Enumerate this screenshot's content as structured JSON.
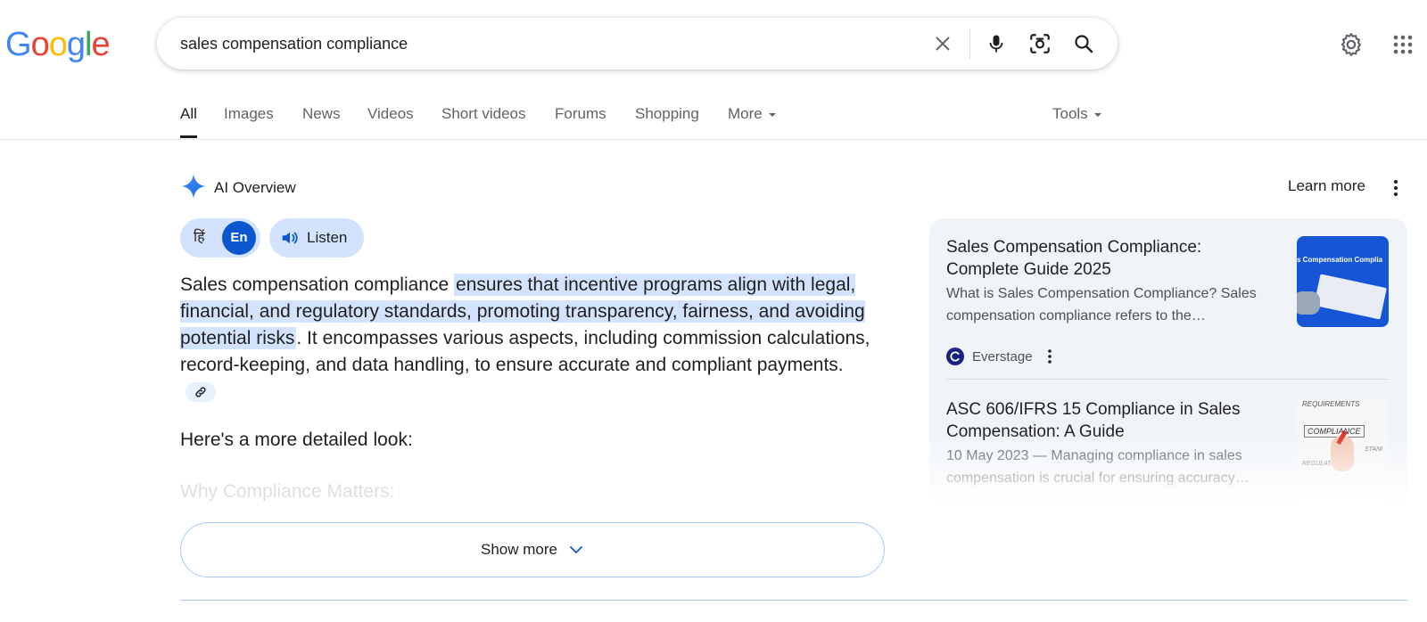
{
  "brand": {
    "logo_letters": [
      {
        "ch": "G",
        "color": "#4285F4"
      },
      {
        "ch": "o",
        "color": "#EA4335"
      },
      {
        "ch": "o",
        "color": "#FBBC05"
      },
      {
        "ch": "g",
        "color": "#4285F4"
      },
      {
        "ch": "l",
        "color": "#34A853"
      },
      {
        "ch": "e",
        "color": "#EA4335"
      }
    ]
  },
  "search": {
    "query": "sales compensation compliance",
    "icons": [
      "clear-icon",
      "microphone-icon",
      "lens-icon",
      "search-icon"
    ]
  },
  "header_icons": [
    "settings-gear-icon",
    "apps-grid-icon"
  ],
  "tabs": [
    {
      "label": "All",
      "active": true
    },
    {
      "label": "Images"
    },
    {
      "label": "News"
    },
    {
      "label": "Videos"
    },
    {
      "label": "Short videos"
    },
    {
      "label": "Forums"
    },
    {
      "label": "Shopping"
    },
    {
      "label": "More",
      "dropdown": true
    },
    {
      "label": "Tools",
      "dropdown": true
    }
  ],
  "ai_overview": {
    "title": "AI Overview",
    "learn_more": "Learn more",
    "lang_hi": "हिं",
    "lang_en": "En",
    "listen": "Listen",
    "para1_plain": "Sales compensation compliance ",
    "para1_highlight": "ensures that incentive programs align with legal, financial, and regulatory standards, promoting transparency, fairness, and avoiding potential risks",
    "para1_rest": ". It encompasses various aspects, including commission calculations, record-keeping, and data handling, to ensure accurate and compliant payments.",
    "para2": "Here's a more detailed look:",
    "faded_heading": "Why Compliance Matters:",
    "show_more": "Show more",
    "accent_color": "#0b57d0",
    "highlight_color": "#d3e3fd"
  },
  "sources": [
    {
      "title": "Sales Compensation Compliance: Complete Guide 2025",
      "snippet": "What is Sales Compensation Compliance? Sales compensation compliance refers to the…",
      "site": "Everstage",
      "thumb_text": "s Compensation Complia"
    },
    {
      "title": "ASC 606/IFRS 15 Compliance in Sales Compensation: A Guide",
      "snippet": "10 May 2023 — Managing compliance in sales compensation is crucial for ensuring accuracy…",
      "thumb_labels": [
        "REQUIREMENTS",
        "COMPLIANCE",
        "REGULATIONS",
        "STANI"
      ]
    }
  ]
}
